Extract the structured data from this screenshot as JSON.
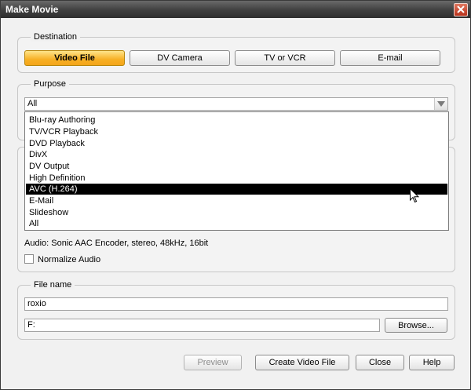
{
  "window": {
    "title": "Make Movie"
  },
  "destination": {
    "legend": "Destination",
    "buttons": [
      {
        "label": "Video File",
        "active": true
      },
      {
        "label": "DV Camera",
        "active": false
      },
      {
        "label": "TV or VCR",
        "active": false
      },
      {
        "label": "E-mail",
        "active": false
      }
    ]
  },
  "purpose": {
    "legend": "Purpose",
    "selected": "All",
    "options": [
      "Blu-ray Authoring",
      "TV/VCR Playback",
      "DVD Playback",
      "DivX",
      "DV Output",
      "High Definition",
      "AVC (H.264)",
      "E-Mail",
      "Slideshow",
      "All"
    ],
    "highlighted": "AVC (H.264)"
  },
  "settings": {
    "audio_text": "Audio: Sonic AAC Encoder, stereo, 48kHz, 16bit",
    "normalize_label": "Normalize Audio",
    "normalize_checked": false
  },
  "file": {
    "legend": "File name",
    "name_value": "roxio",
    "path_value": "F:",
    "browse_label": "Browse..."
  },
  "footer": {
    "preview_label": "Preview",
    "create_label": "Create Video File",
    "close_label": "Close",
    "help_label": "Help"
  },
  "colors": {
    "active_button": "#f7b024",
    "selection": "#000000",
    "titlebar": "#3f3f3f"
  }
}
